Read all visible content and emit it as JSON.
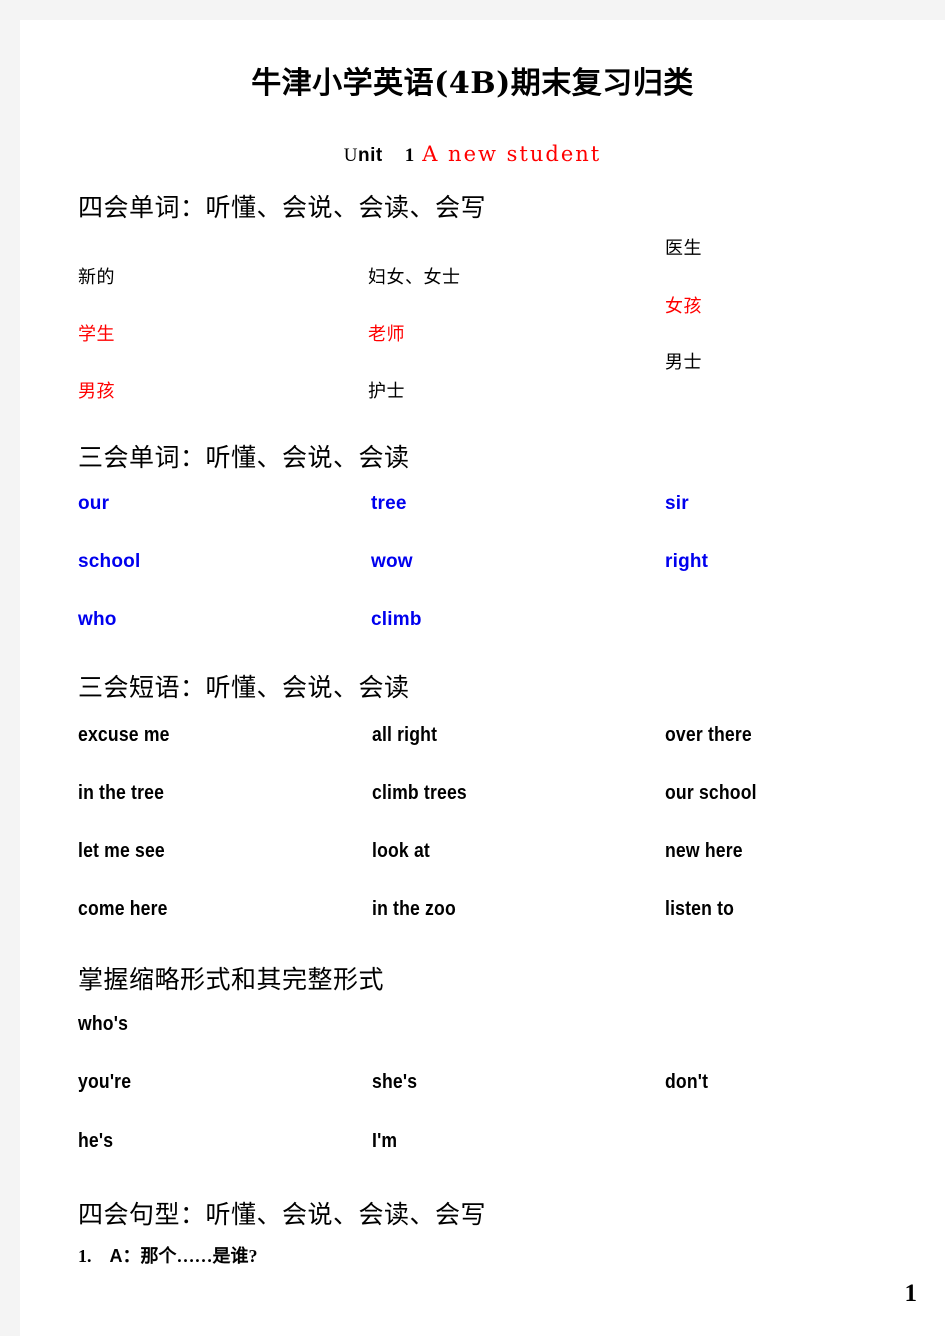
{
  "document": {
    "title": "牛津小学英语(4B)期末复习归类",
    "page_number": "1"
  },
  "unit": {
    "label_cap": "U",
    "label_rest": "nit",
    "number": "1",
    "topic": "A new student"
  },
  "sections": [
    {
      "heading": "四会单词：听懂、会说、会读、会写",
      "columns": [
        [
          {
            "text": "新的",
            "color": "#000000"
          },
          {
            "text": "学生",
            "color": "#ff0000"
          },
          {
            "text": "男孩",
            "color": "#ff0000"
          }
        ],
        [
          {
            "text": "妇女、女士",
            "color": "#000000"
          },
          {
            "text": "老师",
            "color": "#ff0000"
          },
          {
            "text": "护士",
            "color": "#000000"
          }
        ],
        [
          {
            "text": "医生",
            "color": "#000000"
          },
          {
            "text": "女孩",
            "color": "#ff0000"
          },
          {
            "text": "男士",
            "color": "#000000"
          }
        ]
      ]
    },
    {
      "heading": "三会单词：听懂、会说、会读",
      "columns": [
        [
          {
            "text": "our"
          },
          {
            "text": "school"
          },
          {
            "text": "who"
          }
        ],
        [
          {
            "text": "tree"
          },
          {
            "text": "wow"
          },
          {
            "text": "climb"
          }
        ],
        [
          {
            "text": "sir"
          },
          {
            "text": "right"
          },
          {
            "text": ""
          }
        ]
      ]
    },
    {
      "heading": "三会短语：听懂、会说、会读",
      "columns": [
        [
          {
            "text": "excuse me"
          },
          {
            "text": "in the tree"
          },
          {
            "text": "let me see"
          },
          {
            "text": "come here"
          }
        ],
        [
          {
            "text": "all right"
          },
          {
            "text": "climb trees"
          },
          {
            "text": "look at"
          },
          {
            "text": "in the zoo"
          }
        ],
        [
          {
            "text": "over there"
          },
          {
            "text": "our school"
          },
          {
            "text": "new here"
          },
          {
            "text": "listen to"
          }
        ]
      ]
    },
    {
      "heading": "掌握缩略形式和其完整形式",
      "columns": [
        [
          {
            "text": "who's"
          },
          {
            "text": "you're"
          },
          {
            "text": "he's"
          }
        ],
        [
          {
            "text": ""
          },
          {
            "text": "she's"
          },
          {
            "text": "I'm"
          }
        ],
        [
          {
            "text": ""
          },
          {
            "text": "don't"
          },
          {
            "text": ""
          }
        ]
      ]
    },
    {
      "heading": "四会句型：听懂、会说、会读、会写"
    }
  ],
  "sentences": [
    {
      "number": "1.",
      "speaker": "A：",
      "text": "那个……是谁?"
    }
  ],
  "colors": {
    "red": "#ff0000",
    "blue": "#0000ee",
    "black": "#000000",
    "page_background": "#ffffff",
    "canvas_background": "#f4f4f4"
  }
}
